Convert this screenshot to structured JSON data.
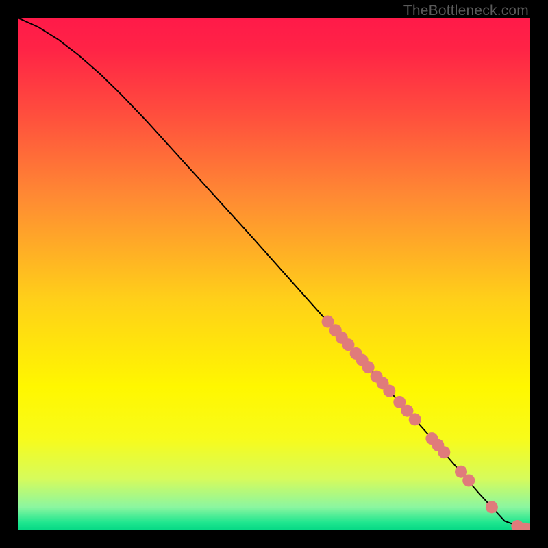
{
  "watermark": "TheBottleneck.com",
  "chart_data": {
    "type": "line",
    "title": "",
    "xlabel": "",
    "ylabel": "",
    "xlim": [
      0,
      100
    ],
    "ylim": [
      0,
      100
    ],
    "grid": false,
    "legend": false,
    "background_gradient": {
      "stops": [
        {
          "pos": 0.0,
          "color": "#ff1a49"
        },
        {
          "pos": 0.06,
          "color": "#ff2346"
        },
        {
          "pos": 0.18,
          "color": "#ff4b3e"
        },
        {
          "pos": 0.35,
          "color": "#ff8a33"
        },
        {
          "pos": 0.55,
          "color": "#ffd019"
        },
        {
          "pos": 0.72,
          "color": "#fff700"
        },
        {
          "pos": 0.82,
          "color": "#f8fb1a"
        },
        {
          "pos": 0.9,
          "color": "#d6fb5c"
        },
        {
          "pos": 0.955,
          "color": "#8bf6a0"
        },
        {
          "pos": 0.985,
          "color": "#1fe68f"
        },
        {
          "pos": 1.0,
          "color": "#05d885"
        }
      ]
    },
    "series": [
      {
        "name": "curve",
        "type": "line",
        "color": "#000000",
        "width": 2,
        "x": [
          0,
          4,
          8,
          12,
          16,
          20,
          25,
          30,
          35,
          40,
          45,
          50,
          55,
          60,
          65,
          70,
          75,
          80,
          85,
          90,
          95,
          100
        ],
        "y": [
          100,
          98.2,
          95.7,
          92.6,
          89.1,
          85.2,
          80.0,
          74.5,
          69.0,
          63.5,
          58.0,
          52.4,
          46.8,
          41.2,
          35.6,
          30.0,
          24.4,
          18.8,
          13.0,
          7.2,
          1.8,
          0.0
        ]
      },
      {
        "name": "highlight-points",
        "type": "scatter",
        "color": "#e07b7b",
        "radius": 9,
        "x": [
          60.5,
          62.0,
          63.2,
          64.5,
          66.0,
          67.2,
          68.4,
          70.0,
          71.2,
          72.5,
          74.5,
          76.0,
          77.5,
          80.8,
          82.0,
          83.2,
          86.5,
          88.0,
          92.5,
          97.5,
          99.0,
          99.8
        ],
        "y": [
          40.7,
          39.0,
          37.6,
          36.2,
          34.5,
          33.2,
          31.8,
          30.0,
          28.7,
          27.2,
          25.0,
          23.3,
          21.6,
          17.9,
          16.6,
          15.2,
          11.4,
          9.7,
          4.5,
          0.8,
          0.3,
          0.1
        ]
      }
    ]
  }
}
